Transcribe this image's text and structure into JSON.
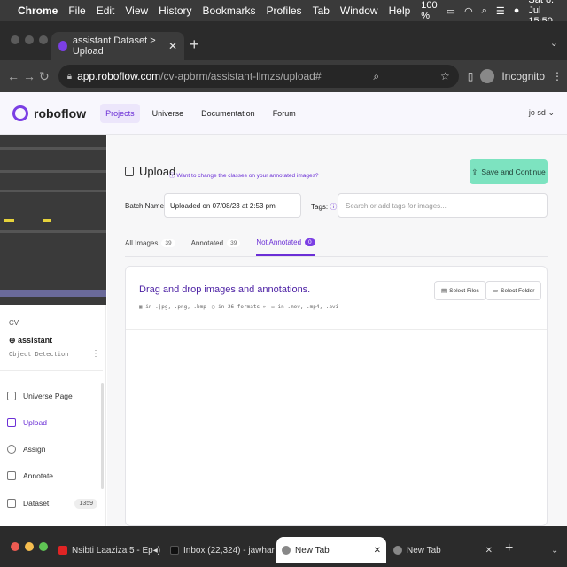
{
  "menubar": {
    "app": "Chrome",
    "items": [
      "File",
      "Edit",
      "View",
      "History",
      "Bookmarks",
      "Profiles",
      "Tab",
      "Window",
      "Help"
    ],
    "battery": "100 %",
    "datetime": "Sat 8. Jul  15:50"
  },
  "browser": {
    "active_tab_title": "assistant Dataset > Upload",
    "url_host": "app.roboflow.com",
    "url_path": "/cv-apbrm/assistant-llmzs/upload#",
    "profile": "Incognito"
  },
  "header": {
    "brand": "roboflow",
    "nav": [
      "Projects",
      "Universe",
      "Documentation",
      "Forum"
    ],
    "user": "jo sd"
  },
  "sidebar": {
    "workspace": "CV",
    "project_name": "assistant",
    "project_type": "Object Detection",
    "items": [
      {
        "label": "Universe Page",
        "icon": "book-icon"
      },
      {
        "label": "Upload",
        "icon": "upload-icon"
      },
      {
        "label": "Assign",
        "icon": "search-icon"
      },
      {
        "label": "Annotate",
        "icon": "annotate-icon"
      },
      {
        "label": "Dataset",
        "icon": "dataset-icon",
        "count": "1359"
      }
    ]
  },
  "main": {
    "title": "Upload",
    "help_link": "Want to change the classes on your annotated images?",
    "save_button": "Save and Continue",
    "batch_label": "Batch Name:",
    "batch_value": "Uploaded on 07/08/23 at 2:53 pm",
    "tags_label": "Tags:",
    "tags_placeholder": "Search or add tags for images...",
    "tabs": [
      {
        "label": "All Images",
        "count": "39"
      },
      {
        "label": "Annotated",
        "count": "39"
      },
      {
        "label": "Not Annotated",
        "count": "0"
      }
    ],
    "drop_title": "Drag and drop images and annotations.",
    "formats": [
      "in .jpg, .png, .bmp",
      "in 26 formats »",
      "in .mov, .mp4, .avi"
    ],
    "select_files": "Select Files",
    "select_folder": "Select Folder"
  },
  "bottom_tabs": [
    {
      "title": "Nsibti Laaziza 5 - Ep",
      "color": "#e02424"
    },
    {
      "title": "Inbox (22,324) - jawhar",
      "color": "#111111"
    },
    {
      "title": "New Tab",
      "color": "#888888"
    },
    {
      "title": "New Tab",
      "color": "#888888"
    }
  ],
  "colors": {
    "accent": "#7b3fe4",
    "save_green": "#7de3c0"
  }
}
